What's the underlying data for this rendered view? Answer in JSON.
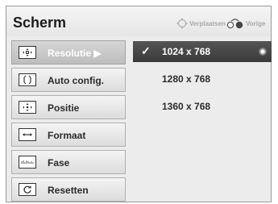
{
  "header": {
    "title": "Scherm",
    "hint_move_label": "Verplaatsen",
    "hint_back_label": "Vorige"
  },
  "menu": {
    "items": [
      {
        "label": "Resolutie ▶",
        "icon": "resolution-icon"
      },
      {
        "label": "Auto config.",
        "icon": "auto-config-icon"
      },
      {
        "label": "Positie",
        "icon": "position-icon"
      },
      {
        "label": "Formaat",
        "icon": "format-icon"
      },
      {
        "label": "Fase",
        "icon": "phase-icon"
      },
      {
        "label": "Resetten",
        "icon": "reset-icon"
      }
    ],
    "active_index": 0
  },
  "options": {
    "items": [
      {
        "label": "1024 x 768",
        "selected": true
      },
      {
        "label": "1280 x 768",
        "selected": false
      },
      {
        "label": "1360 x 768",
        "selected": false
      }
    ],
    "check_mark": "✓"
  },
  "colors": {
    "selected_bg": "#444444",
    "active_menu_bg": "#c8c8c8",
    "panel_bg": "#ececec"
  }
}
